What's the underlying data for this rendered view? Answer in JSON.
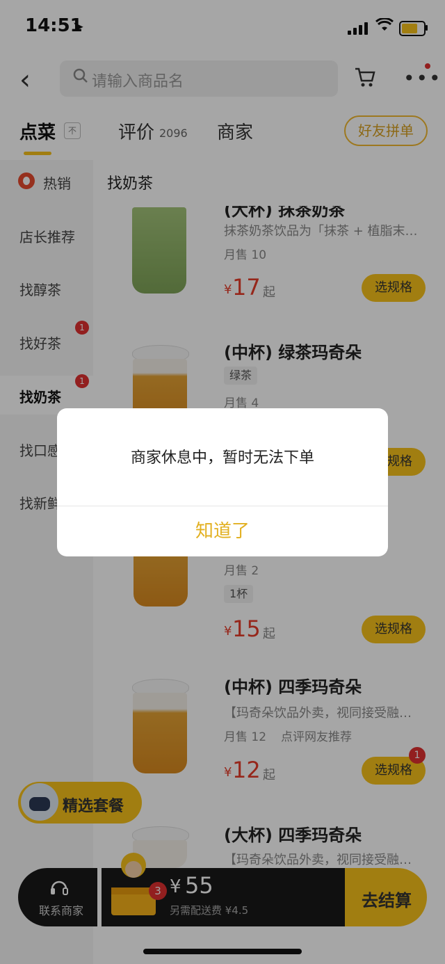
{
  "status_bar": {
    "time": "14:51"
  },
  "search": {
    "placeholder": "请输入商品名"
  },
  "tabs": [
    {
      "label": "点菜",
      "pin": "不"
    },
    {
      "label": "评价",
      "count": "2096"
    },
    {
      "label": "商家"
    }
  ],
  "group_order_label": "好友拼单",
  "sidebar": {
    "items": [
      {
        "label": "热销"
      },
      {
        "label": "店长推荐"
      },
      {
        "label": "找醇茶"
      },
      {
        "label": "找好茶",
        "badge": "1"
      },
      {
        "label": "找奶茶",
        "badge": "1"
      },
      {
        "label": "找口感"
      },
      {
        "label": "找新鲜"
      }
    ]
  },
  "section_title": "找奶茶",
  "items": [
    {
      "name": "(大杯) 抹茶奶茶",
      "desc": "抹茶奶茶饮品为「抹茶 + 植脂末…",
      "sales": "月售 10",
      "price_symbol": "¥",
      "price": "17",
      "price_suffix": "起",
      "button": "选规格"
    },
    {
      "name": "(中杯) 绿茶玛奇朵",
      "tag": "绿茶",
      "sales": "月售 4",
      "button": "选规格"
    },
    {
      "sales": "月售 2",
      "tag": "1杯",
      "price_symbol": "¥",
      "price": "15",
      "price_suffix": "起",
      "button": "选规格"
    },
    {
      "name": "(中杯) 四季玛奇朵",
      "desc": "【玛奇朵饮品外卖，视同接受融…",
      "sales": "月售 12",
      "recommend": "点评网友推荐",
      "price_symbol": "¥",
      "price": "12",
      "price_suffix": "起",
      "button": "选规格",
      "badge": "1"
    },
    {
      "name": "(大杯) 四季玛奇朵",
      "desc": "【玛奇朵饮品外卖，视同接受融…"
    }
  ],
  "combo_label": "精选套餐",
  "bottom_bar": {
    "contact_label": "联系商家",
    "cart_count": "3",
    "total_symbol": "¥",
    "total": "55",
    "delivery_note": "另需配送费 ¥4.5",
    "checkout_label": "去结算"
  },
  "modal": {
    "message": "商家休息中，暂时无法下单",
    "button": "知道了"
  },
  "colors": {
    "accent": "#f7c21b",
    "price": "#e63c2a",
    "badge": "#e03030",
    "modal_button": "#e2b021"
  }
}
